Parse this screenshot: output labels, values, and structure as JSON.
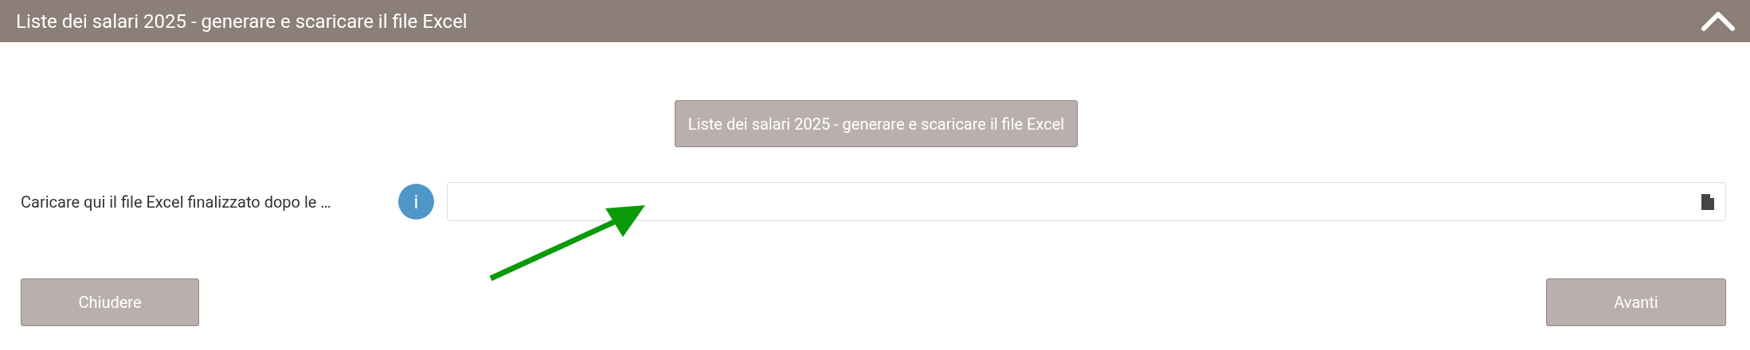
{
  "header": {
    "title": "Liste dei salari 2025 - generare e scaricare il file Excel",
    "expanded": true
  },
  "generate_button": {
    "label": "Liste dei salari 2025 - generare e scaricare il file Excel"
  },
  "upload_field": {
    "label": "Caricare qui il file Excel finalizzato dopo le …",
    "info": "i"
  },
  "buttons": [
    {
      "label": "Chiudere",
      "kind": "left"
    },
    {
      "label": "Avanti",
      "kind": "right"
    }
  ]
}
